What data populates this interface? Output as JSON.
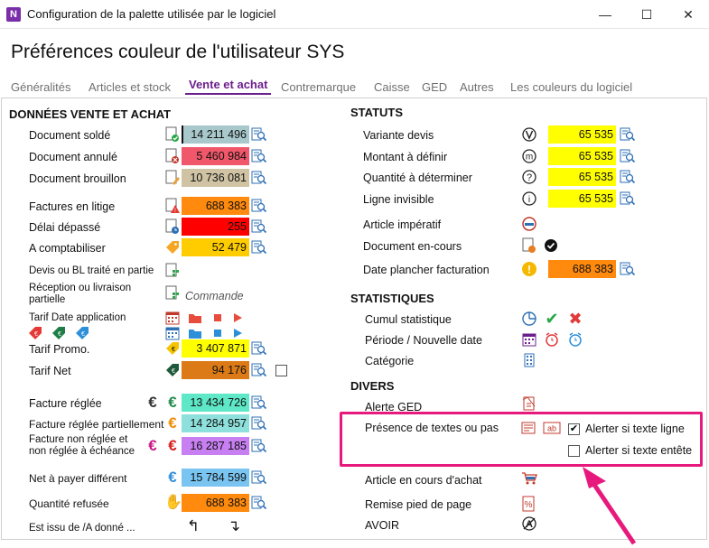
{
  "window": {
    "app_icon": "N",
    "title": "Configuration de la palette utilisée par le logiciel",
    "min": "—",
    "max": "☐",
    "close": "✕"
  },
  "page_title": "Préférences couleur de l'utilisateur SYS",
  "tabs": [
    "Généralités",
    "Articles et stock",
    "Vente et achat",
    "Contremarque",
    "Caisse",
    "GED",
    "Autres",
    "Les couleurs du logiciel"
  ],
  "active_tab": "Vente et achat",
  "left": {
    "title": "DONNÉES VENTE ET ACHAT",
    "rows": {
      "solde": {
        "label": "Document soldé",
        "value": "14 211 496",
        "color": "#a8c8cc"
      },
      "annule": {
        "label": "Document annulé",
        "value": "5 460 984",
        "color": "#f0576a"
      },
      "brouillon": {
        "label": "Document brouillon",
        "value": "10 736 081",
        "color": "#cfc3a4"
      },
      "litige": {
        "label": "Factures en litige",
        "value": "688 383",
        "color": "#ff8a0d"
      },
      "delai": {
        "label": "Délai dépassé",
        "value": "255",
        "color": "#fe0000"
      },
      "comptabiliser": {
        "label": "A comptabiliser",
        "value": "52 479",
        "color": "#ffcc00"
      },
      "devis_bl": {
        "label": "Devis ou BL traité en partie"
      },
      "reception": {
        "label": "Réception ou livraison partielle",
        "note": "Commande"
      },
      "tarif_date": {
        "label": "Tarif Date application"
      },
      "promo": {
        "label": "Tarif Promo.",
        "value": "3 407 871",
        "color": "#ffff00"
      },
      "net": {
        "label": "Tarif Net",
        "value": "94 176",
        "color": "#db7a16"
      },
      "reglee": {
        "label": "Facture réglée",
        "value": "13 434 726",
        "color": "#5ee8c8"
      },
      "partielle": {
        "label": "Facture réglée partiellement",
        "value": "14 284 957",
        "color": "#8de0db"
      },
      "non_reglee": {
        "label": "Facture non réglée et non réglée à échéance",
        "value": "16 287 185",
        "color": "#c77ff2"
      },
      "net_payer": {
        "label": "Net à payer différent",
        "value": "15 784 599",
        "color": "#79c4f0"
      },
      "refusee": {
        "label": "Quantité refusée",
        "value": "688 383",
        "color": "#ff8a0d"
      },
      "issu": {
        "label": "Est issu de /A donné ..."
      }
    }
  },
  "statuts": {
    "title": "STATUTS",
    "rows": {
      "variante": {
        "label": "Variante devis",
        "value": "65 535",
        "color": "#ffff00"
      },
      "montant": {
        "label": "Montant à définir",
        "value": "65 535",
        "color": "#ffff00"
      },
      "quantite": {
        "label": "Quantité à déterminer",
        "value": "65 535",
        "color": "#ffff00"
      },
      "invisible": {
        "label": "Ligne invisible",
        "value": "65 535",
        "color": "#ffff00"
      },
      "imperatif": {
        "label": "Article impératif"
      },
      "encours": {
        "label": "Document en-cours"
      },
      "plancher": {
        "label": "Date plancher facturation",
        "value": "688 383",
        "color": "#ff8a0d"
      }
    }
  },
  "statistiques": {
    "title": "STATISTIQUES",
    "rows": {
      "cumul": {
        "label": "Cumul statistique"
      },
      "periode": {
        "label": "Période / Nouvelle date"
      },
      "categorie": {
        "label": "Catégorie"
      }
    }
  },
  "divers": {
    "title": "DIVERS",
    "rows": {
      "ged": {
        "label": "Alerte GED"
      },
      "textes": {
        "label": "Présence de textes ou pas",
        "chk1_label": "Alerter si texte ligne",
        "chk1_checked": true,
        "chk2_label": "Alerter si texte entête",
        "chk2_checked": false
      },
      "achat": {
        "label": "Article en cours d'achat"
      },
      "remise": {
        "label": "Remise pied de page"
      },
      "avoir": {
        "label": "AVOIR"
      }
    }
  },
  "colors": {
    "accent": "#6b1f8c",
    "highlight": "#e8197d"
  }
}
